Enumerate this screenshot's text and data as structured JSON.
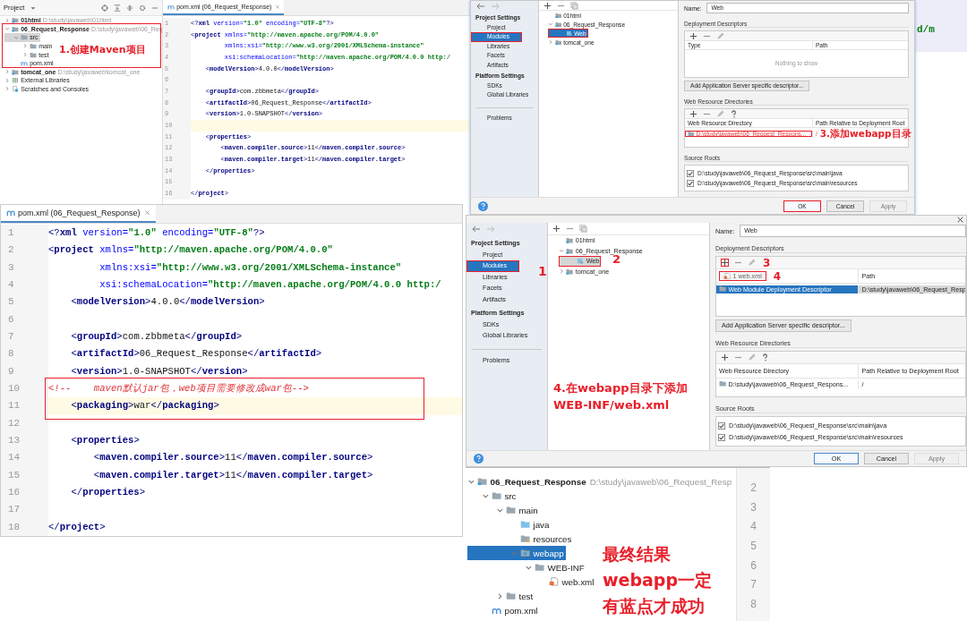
{
  "project_panel": {
    "title": "Project",
    "tree": [
      {
        "kind": "module",
        "label": "01html",
        "path": "D:\\study\\javaweb\\01html",
        "expanded": false,
        "selected": false
      },
      {
        "kind": "module",
        "label": "06_Request_Response",
        "path": "D:\\study\\javaweb\\06_Req",
        "expanded": true,
        "selected": false,
        "children": [
          {
            "kind": "folder",
            "label": "src",
            "expanded": true,
            "selected": true,
            "children": [
              {
                "kind": "folder",
                "label": "main",
                "expanded": false,
                "selected": false
              },
              {
                "kind": "folder",
                "label": "test",
                "expanded": false,
                "selected": false
              }
            ]
          },
          {
            "kind": "pom-file",
            "label": "pom.xml",
            "selected": false
          }
        ]
      },
      {
        "kind": "module",
        "label": "tomcat_one",
        "path": "D:\\study\\javaweb\\tomcat_one",
        "expanded": false,
        "selected": false
      },
      {
        "kind": "library",
        "label": "External Libraries",
        "expanded": false,
        "selected": false
      },
      {
        "kind": "scratches",
        "label": "Scratches and Consoles",
        "expanded": false,
        "selected": false
      }
    ],
    "annotations": [
      "1.创建Maven项目"
    ]
  },
  "editor_top": {
    "tab": "pom.xml (06_Request_Response)",
    "lines": [
      {
        "number": "1",
        "kind": "code",
        "text": "<?xml version=\"1.0\" encoding=\"UTF-8\"?>",
        "current": false
      },
      {
        "number": "2",
        "kind": "code",
        "text": "<project xmlns=\"http://maven.apache.org/POM/4.0.0\"",
        "current": false
      },
      {
        "number": "3",
        "kind": "code",
        "text": "         xmlns:xsi=\"http://www.w3.org/2001/XMLSchema-instance\"",
        "current": false
      },
      {
        "number": "4",
        "kind": "code",
        "text": "         xsi:schemaLocation=\"http://maven.apache.org/POM/4.0.0 http:/",
        "current": false
      },
      {
        "number": "5",
        "kind": "code",
        "text": "    <modelVersion>4.0.0</modelVersion>",
        "current": false
      },
      {
        "number": "6",
        "kind": "code",
        "current": false
      },
      {
        "number": "7",
        "kind": "code",
        "text": "    <groupId>com.zbbmeta</groupId>",
        "current": false
      },
      {
        "number": "8",
        "kind": "code",
        "text": "    <artifactId>06_Request_Response</artifactId>",
        "current": false
      },
      {
        "number": "9",
        "kind": "code",
        "text": "    <version>1.0-SNAPSHOT</version>",
        "current": false
      },
      {
        "number": "10",
        "kind": "code",
        "current": true
      },
      {
        "number": "11",
        "kind": "code",
        "text": "    <properties>",
        "current": false
      },
      {
        "number": "12",
        "kind": "code",
        "text": "        <maven.compiler.source>11</maven.compiler.source>",
        "current": false
      },
      {
        "number": "13",
        "kind": "code",
        "text": "        <maven.compiler.target>11</maven.compiler.target>",
        "current": false
      },
      {
        "number": "14",
        "kind": "code",
        "text": "    </properties>",
        "current": false
      },
      {
        "number": "15",
        "kind": "code",
        "current": false
      },
      {
        "number": "16",
        "kind": "code",
        "text": "</project>",
        "current": false
      }
    ]
  },
  "structure_dialog_top": {
    "nav": [
      {
        "heading": "Project Settings",
        "items": [
          {
            "label": "Project",
            "selected": false
          },
          {
            "label": "Modules",
            "selected": true
          },
          {
            "label": "Libraries",
            "selected": false
          },
          {
            "label": "Facets",
            "selected": false
          },
          {
            "label": "Artifacts",
            "selected": false
          }
        ]
      },
      {
        "heading": "Platform Settings",
        "items": [
          {
            "label": "SDKs",
            "selected": false
          },
          {
            "label": "Global Libraries",
            "selected": false
          }
        ]
      },
      {
        "items": [
          {
            "label": "Problems",
            "selected": false
          }
        ]
      }
    ],
    "modules": [
      {
        "kind": "module",
        "label": "01html",
        "selected": false
      },
      {
        "kind": "module",
        "label": "06_Request_Response",
        "expanded": true,
        "selected": false,
        "children": [
          {
            "kind": "web-facet",
            "label": "Web",
            "selected": true
          }
        ]
      },
      {
        "kind": "module",
        "label": "tomcat_one",
        "expanded": false,
        "selected": false
      }
    ],
    "name_field": {
      "label": "Name:",
      "value": "Web"
    },
    "deployment_descriptors": {
      "title": "Deployment Descriptors",
      "columns": [
        {
          "label": "Type"
        },
        {
          "label": "Path"
        }
      ],
      "empty_text": "Nothing to show",
      "button": "Add Application Server specific descriptor..."
    },
    "web_resource_directories": {
      "title": "Web Resource Directories",
      "columns": [
        {
          "label": "Web Resource Directory"
        },
        {
          "label": "Path Relative to Deployment Root"
        }
      ],
      "rows": [
        {
          "cells": [
            "D:\\study\\javaweb\\06_Request_Respons...",
            "/"
          ],
          "invalid": true,
          "selected": false
        }
      ]
    },
    "source_roots": {
      "title": "Source Roots",
      "rows": [
        {
          "path": "D:\\study\\javaweb\\06_Request_Response\\src\\main\\java",
          "checked": true
        },
        {
          "path": "D:\\study\\javaweb\\06_Request_Response\\src\\main\\resources",
          "checked": true
        }
      ]
    },
    "buttons": [
      {
        "label": "OK",
        "default": true,
        "disabled": false
      },
      {
        "label": "Cancel",
        "default": false,
        "disabled": false
      },
      {
        "label": "Apply",
        "default": false,
        "disabled": true
      }
    ],
    "annotations": [
      "3.添加webapp目录"
    ]
  },
  "background_editor": {
    "text": "d/m"
  },
  "editor_main": {
    "tab": "pom.xml (06_Request_Response)",
    "lines": [
      {
        "number": "1",
        "kind": "code",
        "text": "<?xml version=\"1.0\" encoding=\"UTF-8\"?>",
        "current": false
      },
      {
        "number": "2",
        "kind": "code",
        "text": "<project xmlns=\"http://maven.apache.org/POM/4.0.0\"",
        "current": false
      },
      {
        "number": "3",
        "kind": "code",
        "text": "         xmlns:xsi=\"http://www.w3.org/2001/XMLSchema-instance\"",
        "current": false
      },
      {
        "number": "4",
        "kind": "code",
        "text": "         xsi:schemaLocation=\"http://maven.apache.org/POM/4.0.0 http:/",
        "current": false
      },
      {
        "number": "5",
        "kind": "code",
        "text": "    <modelVersion>4.0.0</modelVersion>",
        "current": false
      },
      {
        "number": "6",
        "kind": "code",
        "current": false
      },
      {
        "number": "7",
        "kind": "code",
        "text": "    <groupId>com.zbbmeta</groupId>",
        "current": false
      },
      {
        "number": "8",
        "kind": "code",
        "text": "    <artifactId>06_Request_Response</artifactId>",
        "current": false
      },
      {
        "number": "9",
        "kind": "code",
        "text": "    <version>1.0-SNAPSHOT</version>",
        "current": false
      },
      {
        "number": "10",
        "kind": "comment",
        "text": "<!--    maven默认jar包，web项目需要修改成war包-->",
        "current": false
      },
      {
        "number": "11",
        "kind": "code",
        "text": "    <packaging>war</packaging>",
        "current": true
      },
      {
        "number": "12",
        "kind": "code",
        "current": false
      },
      {
        "number": "13",
        "kind": "code",
        "text": "    <properties>",
        "current": false
      },
      {
        "number": "14",
        "kind": "code",
        "text": "        <maven.compiler.source>11</maven.compiler.source>",
        "current": false
      },
      {
        "number": "15",
        "kind": "code",
        "text": "        <maven.compiler.target>11</maven.compiler.target>",
        "current": false
      },
      {
        "number": "16",
        "kind": "code",
        "text": "    </properties>",
        "current": false
      },
      {
        "number": "17",
        "kind": "code",
        "current": false
      },
      {
        "number": "18",
        "kind": "code",
        "text": "</project>",
        "current": false
      }
    ]
  },
  "structure_dialog_bottom": {
    "nav": [
      {
        "heading": "Project Settings",
        "items": [
          {
            "label": "Project",
            "selected": false
          },
          {
            "label": "Modules",
            "selected": true
          },
          {
            "label": "Libraries",
            "selected": false
          },
          {
            "label": "Facets",
            "selected": false
          },
          {
            "label": "Artifacts",
            "selected": false
          }
        ]
      },
      {
        "heading": "Platform Settings",
        "items": [
          {
            "label": "SDKs",
            "selected": false
          },
          {
            "label": "Global Libraries",
            "selected": false
          }
        ]
      },
      {
        "items": [
          {
            "label": "Problems",
            "selected": false
          }
        ]
      }
    ],
    "modules": [
      {
        "kind": "module",
        "label": "01html",
        "selected": false
      },
      {
        "kind": "module",
        "label": "06_Request_Response",
        "expanded": true,
        "selected": false,
        "children": [
          {
            "kind": "web-facet",
            "label": "Web",
            "selected": true
          }
        ]
      },
      {
        "kind": "module",
        "label": "tomcat_one",
        "expanded": false,
        "selected": false
      }
    ],
    "name_field": {
      "label": "Name:",
      "value": "Web"
    },
    "deployment_descriptors": {
      "title": "Deployment Descriptors",
      "columns": [
        {
          "popup": "1  web.xml"
        },
        {
          "label": "Path"
        }
      ],
      "rows": [
        {
          "cells": [
            "Web Module Deployment Descriptor",
            "D:\\study\\javaweb\\06_Request_Resp"
          ],
          "invalid": false,
          "selected": true
        }
      ],
      "button": "Add Application Server specific descriptor..."
    },
    "web_resource_directories": {
      "title": "Web Resource Directories",
      "columns": [
        {
          "label": "Web Resource Directory"
        },
        {
          "label": "Path Relative to Deployment Root"
        }
      ],
      "rows": [
        {
          "cells": [
            "D:\\study\\javaweb\\06_Request_Respons...",
            "/"
          ],
          "invalid": false,
          "selected": false
        }
      ]
    },
    "source_roots": {
      "title": "Source Roots",
      "rows": [
        {
          "path": "D:\\study\\javaweb\\06_Request_Response\\src\\main\\java",
          "checked": true
        },
        {
          "path": "D:\\study\\javaweb\\06_Request_Response\\src\\main\\resources",
          "checked": true
        }
      ]
    },
    "buttons": [
      {
        "label": "OK",
        "default": true,
        "disabled": false
      },
      {
        "label": "Cancel",
        "default": false,
        "disabled": false
      },
      {
        "label": "Apply",
        "default": false,
        "disabled": true
      }
    ],
    "annotations": [
      "1",
      "2",
      "3",
      "4",
      "4.在webapp目录下添加",
      "WEB-INF/web.xml"
    ]
  },
  "result_tree": {
    "tree": [
      {
        "kind": "module",
        "label": "06_Request_Response",
        "path": "D:\\study\\javaweb\\06_Request_Resp",
        "expanded": true,
        "selected": false,
        "children": [
          {
            "kind": "folder",
            "label": "src",
            "expanded": true,
            "selected": false,
            "children": [
              {
                "kind": "folder",
                "label": "main",
                "expanded": true,
                "selected": false,
                "children": [
                  {
                    "kind": "source-folder",
                    "label": "java",
                    "selected": false
                  },
                  {
                    "kind": "resource-folder",
                    "label": "resources",
                    "selected": false
                  },
                  {
                    "kind": "web-folder",
                    "label": "webapp",
                    "expanded": true,
                    "selected": true,
                    "children": [
                      {
                        "kind": "folder",
                        "label": "WEB-INF",
                        "expanded": true,
                        "selected": false,
                        "children": [
                          {
                            "kind": "xml-file",
                            "label": "web.xml",
                            "selected": false
                          }
                        ]
                      }
                    ]
                  }
                ]
              },
              {
                "kind": "folder",
                "label": "test",
                "expanded": false,
                "selected": false
              }
            ]
          },
          {
            "kind": "pom-file",
            "label": "pom.xml",
            "selected": false
          }
        ]
      }
    ],
    "line_numbers": [
      "2",
      "3",
      "4",
      "5",
      "6",
      "7",
      "8"
    ],
    "annotations": [
      "最终结果",
      "webapp一定",
      "有蓝点才成功"
    ]
  }
}
